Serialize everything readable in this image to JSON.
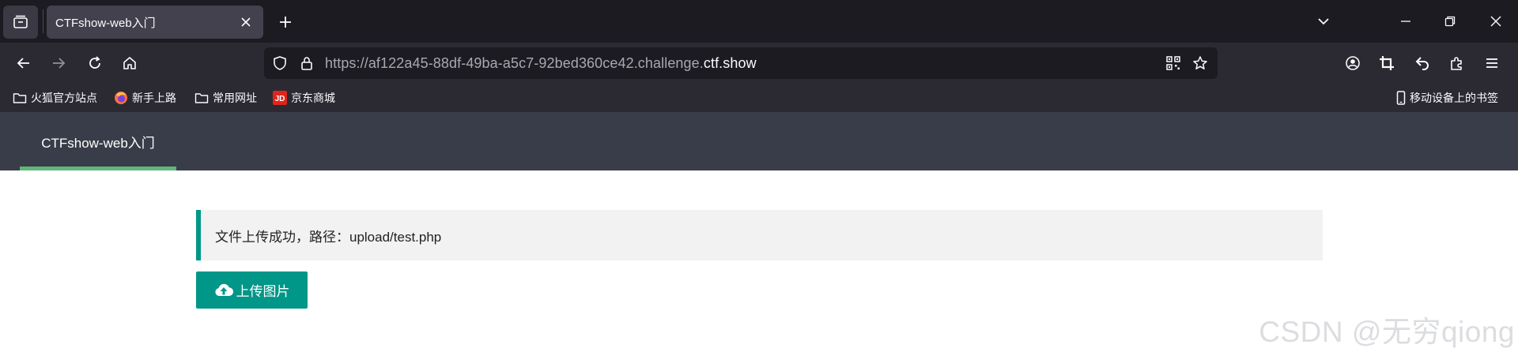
{
  "browser": {
    "tab": {
      "title": "CTFshow-web入门",
      "close_icon": "close-icon"
    },
    "url": {
      "prefix": "https://af122a45-88df-49ba-a5c7-92bed360ce42.challenge.",
      "domain": "ctf.show"
    },
    "bookmarks": [
      {
        "label": "火狐官方站点",
        "icon": "folder-icon"
      },
      {
        "label": "新手上路",
        "icon": "firefox-icon"
      },
      {
        "label": "常用网址",
        "icon": "folder-icon"
      },
      {
        "label": "京东商城",
        "icon": "jd-icon"
      }
    ],
    "mobile_bookmarks": "移动设备上的书签",
    "colors": {
      "tabbar": "#1c1b22",
      "toolbar": "#2b2a33",
      "active_tab": "#42414d"
    }
  },
  "page": {
    "nav": {
      "item": "CTFshow-web入门",
      "active_color": "#5fb878",
      "bg": "#393d49"
    },
    "notice": {
      "text": "文件上传成功，路径：upload/test.php",
      "accent": "#009688"
    },
    "upload_button": {
      "label": "上传图片",
      "icon": "cloud-upload-icon",
      "color": "#009688"
    },
    "watermark": "CSDN @无穷qiong"
  }
}
